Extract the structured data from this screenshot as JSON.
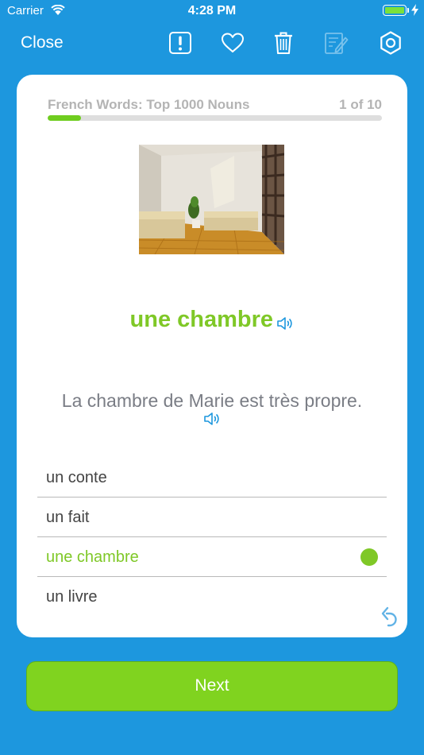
{
  "status_bar": {
    "carrier": "Carrier",
    "time": "4:28 PM"
  },
  "nav": {
    "close_label": "Close",
    "icons": [
      "report-icon",
      "heart-icon",
      "trash-icon",
      "edit-icon",
      "settings-icon"
    ]
  },
  "card": {
    "set_title": "French Words: Top 1000 Nouns",
    "progress_text": "1 of 10",
    "progress_fraction": 0.1,
    "word": "une chambre",
    "sentence": "La chambre de Marie est très propre.",
    "options": [
      {
        "label": "un conte",
        "correct": false
      },
      {
        "label": "un fait",
        "correct": false
      },
      {
        "label": "une chambre",
        "correct": true
      },
      {
        "label": "un livre",
        "correct": false
      }
    ]
  },
  "next_label": "Next",
  "colors": {
    "background": "#1d97de",
    "accent_green": "#7fc827",
    "button_green": "#80d31f",
    "speaker_blue": "#1d97de"
  }
}
